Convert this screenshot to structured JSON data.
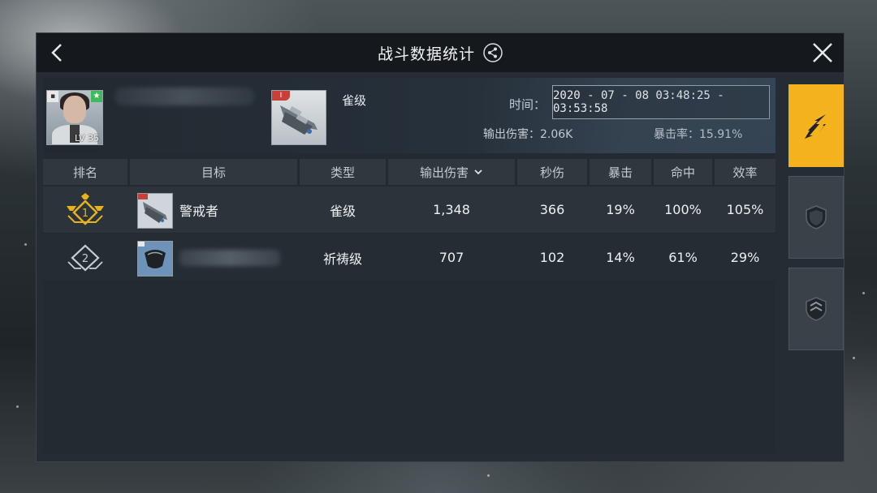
{
  "title": "战斗数据统计",
  "header": {
    "player_level": "LV 35",
    "ship_tag": "I",
    "ship_class": "雀级",
    "time_label": "时间：",
    "time_value": "2020 - 07 - 08  03:48:25 - 03:53:58",
    "damage_label": "输出伤害：2.06K",
    "crit_label": "暴击率：15.91%"
  },
  "table": {
    "columns": [
      "排名",
      "目标",
      "类型",
      "输出伤害",
      "秒伤",
      "暴击",
      "命中",
      "效率"
    ],
    "rows": [
      {
        "rank": "1",
        "name": "警戒者",
        "type": "雀级",
        "damage": "1,348",
        "dps": "366",
        "crit": "19%",
        "hit": "100%",
        "efficiency": "105%"
      },
      {
        "rank": "2",
        "name": "",
        "type": "祈祷级",
        "damage": "707",
        "dps": "102",
        "crit": "14%",
        "hit": "61%",
        "efficiency": "29%"
      }
    ]
  },
  "side_tabs": [
    {
      "icon": "attack-ships-icon",
      "active": true
    },
    {
      "icon": "shield-icon",
      "active": false
    },
    {
      "icon": "armor-shield-icon",
      "active": false
    }
  ],
  "colors": {
    "accent": "#f4b31c",
    "panel": "#252c33",
    "titlebar": "#15191d",
    "rank_gold": "#e8b21c",
    "rank_silver": "#c9ced3"
  }
}
